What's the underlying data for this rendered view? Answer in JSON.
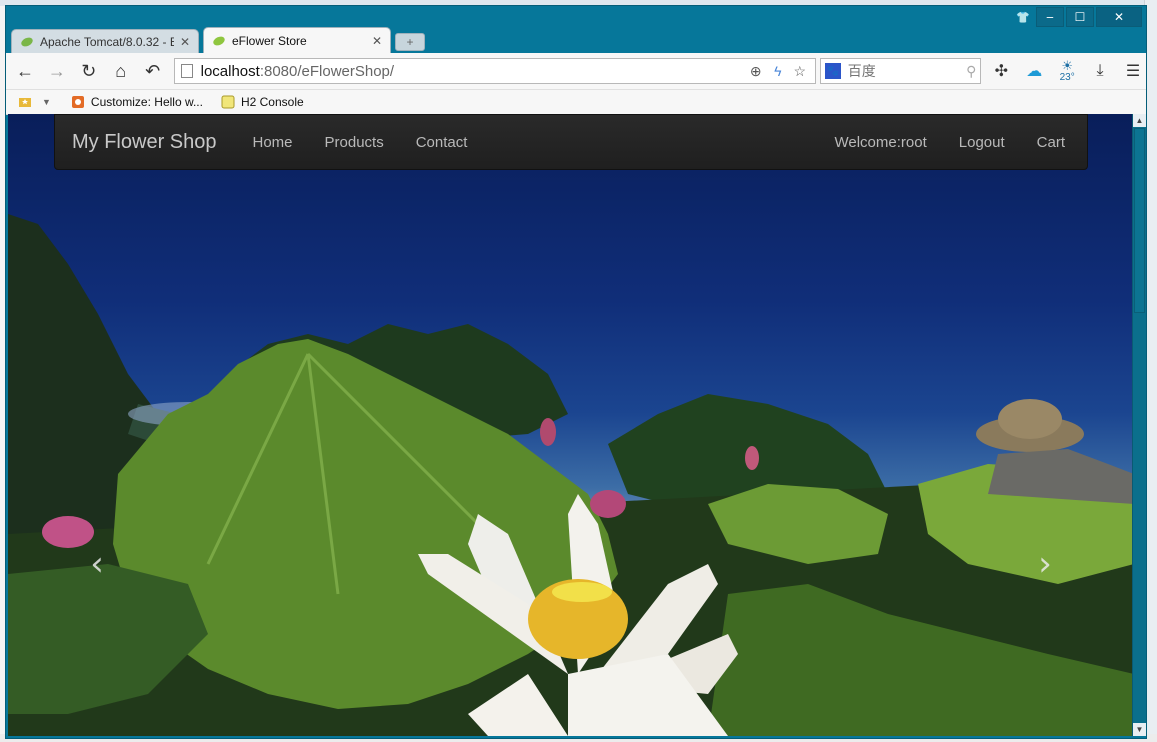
{
  "tabs": [
    {
      "title": "Apache Tomcat/8.0.32 - E",
      "active": false
    },
    {
      "title": "eFlower Store",
      "active": true
    }
  ],
  "toolbar": {
    "url_host": "localhost",
    "url_rest": ":8080/eFlowerShop/",
    "search_placeholder": "百度",
    "weather_temp": "23°"
  },
  "bookmarks": [
    {
      "label": "Customize: Hello w..."
    },
    {
      "label": "H2 Console"
    }
  ],
  "navbar": {
    "brand": "My Flower Shop",
    "links": [
      "Home",
      "Products",
      "Contact"
    ],
    "right_links": [
      "Welcome:root",
      "Logout",
      "Cart"
    ]
  },
  "carousel": {
    "prev_icon": "chevron-left-icon",
    "next_icon": "chevron-right-icon"
  },
  "colors": {
    "window_frame": "#06779a",
    "navbar_bg": "#222222",
    "sky": "#102e79"
  }
}
